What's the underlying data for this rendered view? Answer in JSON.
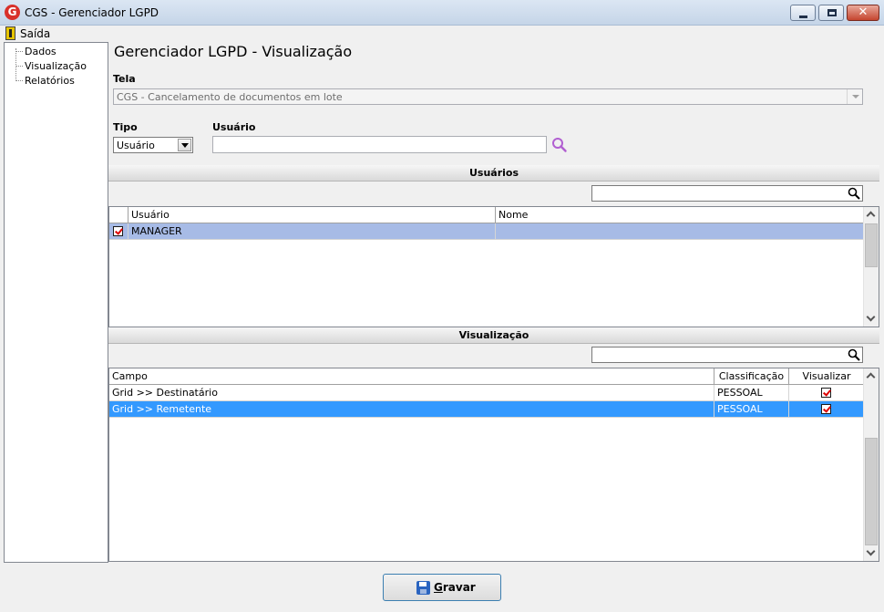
{
  "window": {
    "title": "CGS - Gerenciador LGPD",
    "icon_letter": "G",
    "close_glyph": "✕"
  },
  "menu": {
    "exit_label": "Saída"
  },
  "tree": {
    "items": [
      "Dados",
      "Visualização",
      "Relatórios"
    ]
  },
  "main": {
    "title": "Gerenciador LGPD - Visualização",
    "tela_label": "Tela",
    "tela_value": "CGS - Cancelamento de documentos em lote",
    "tipo_label": "Tipo",
    "tipo_value": "Usuário",
    "usuario_label": "Usuário",
    "usuario_value": ""
  },
  "usuarios": {
    "section_title": "Usuários",
    "search_value": "",
    "columns": [
      "Usuário",
      "Nome"
    ],
    "rows": [
      {
        "checked": true,
        "usuario": "MANAGER",
        "nome": ""
      }
    ]
  },
  "visualizacao": {
    "section_title": "Visualização",
    "search_value": "",
    "columns": [
      "Campo",
      "Classificação",
      "Visualizar"
    ],
    "rows": [
      {
        "campo": "Grid >> Destinatário",
        "classificacao": "PESSOAL",
        "visualizar": true
      },
      {
        "campo": "Grid >> Remetente",
        "classificacao": "PESSOAL",
        "visualizar": true
      }
    ]
  },
  "footer": {
    "save_label": "Gravar"
  },
  "colors": {
    "row_highlight_light": "#a7bbe6",
    "row_highlight_blue": "#3399ff",
    "check_red": "#dd0000",
    "search_purple": "#b15fd1"
  },
  "icons": {
    "app": "app-logo-icon",
    "exit": "exit-door-icon",
    "search": "search-icon",
    "save": "floppy-disk-icon"
  }
}
